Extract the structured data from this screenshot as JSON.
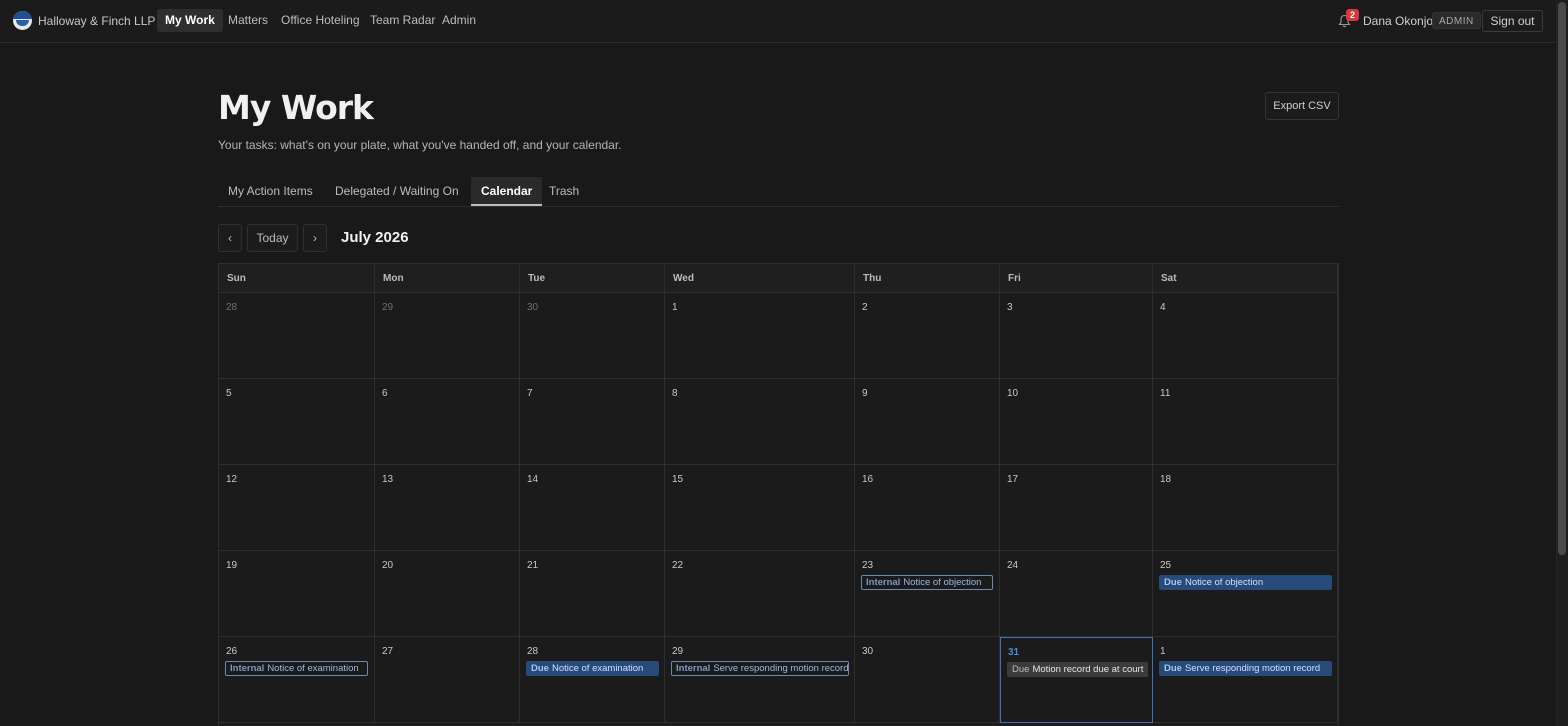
{
  "app": {
    "firm_name": "Halloway & Finch LLP",
    "nav": [
      "My Work",
      "Matters",
      "Office Hoteling",
      "Team Radar",
      "Admin"
    ],
    "active_nav": "My Work"
  },
  "user": {
    "notification_count": "2",
    "name": "Dana Okonjo",
    "role": "ADMIN",
    "signout_label": "Sign out"
  },
  "page": {
    "title": "My Work",
    "subtitle": "Your tasks: what's on your plate, what you've handed off, and your calendar.",
    "export_label": "Export CSV"
  },
  "tabs": [
    "My Action Items",
    "Delegated / Waiting On",
    "Calendar",
    "Trash"
  ],
  "active_tab": "Calendar",
  "calendar": {
    "prev_label": "‹",
    "today_label": "Today",
    "next_label": "›",
    "month_label": "July 2026",
    "weekdays": [
      "Sun",
      "Mon",
      "Tue",
      "Wed",
      "Thu",
      "Fri",
      "Sat"
    ],
    "today": "31",
    "weeks": [
      [
        {
          "day": "28",
          "muted": true
        },
        {
          "day": "29",
          "muted": true
        },
        {
          "day": "30",
          "muted": true
        },
        {
          "day": "1"
        },
        {
          "day": "2"
        },
        {
          "day": "3"
        },
        {
          "day": "4"
        }
      ],
      [
        {
          "day": "5"
        },
        {
          "day": "6"
        },
        {
          "day": "7"
        },
        {
          "day": "8"
        },
        {
          "day": "9"
        },
        {
          "day": "10"
        },
        {
          "day": "11"
        }
      ],
      [
        {
          "day": "12"
        },
        {
          "day": "13"
        },
        {
          "day": "14"
        },
        {
          "day": "15"
        },
        {
          "day": "16"
        },
        {
          "day": "17"
        },
        {
          "day": "18"
        }
      ],
      [
        {
          "day": "19"
        },
        {
          "day": "20"
        },
        {
          "day": "21"
        },
        {
          "day": "22"
        },
        {
          "day": "23",
          "events": [
            {
              "kind": "Internal",
              "title": "Notice of objection",
              "style": "internal"
            }
          ]
        },
        {
          "day": "24"
        },
        {
          "day": "25",
          "events": [
            {
              "kind": "Due",
              "title": "Notice of objection",
              "style": "due"
            }
          ]
        }
      ],
      [
        {
          "day": "26",
          "events": [
            {
              "kind": "Internal",
              "title": "Notice of examination",
              "style": "internal"
            }
          ]
        },
        {
          "day": "27"
        },
        {
          "day": "28",
          "events": [
            {
              "kind": "Due",
              "title": "Notice of examination",
              "style": "due"
            }
          ]
        },
        {
          "day": "29",
          "events": [
            {
              "kind": "Internal",
              "title": "Serve responding motion record",
              "style": "internal"
            }
          ]
        },
        {
          "day": "30"
        },
        {
          "day": "31",
          "today": true,
          "events": [
            {
              "kind": "Due",
              "title": "Motion record due at court",
              "style": "court"
            }
          ]
        },
        {
          "day": "1",
          "muted": false,
          "events": [
            {
              "kind": "Due",
              "title": "Serve responding motion record",
              "style": "due"
            }
          ]
        }
      ]
    ]
  }
}
